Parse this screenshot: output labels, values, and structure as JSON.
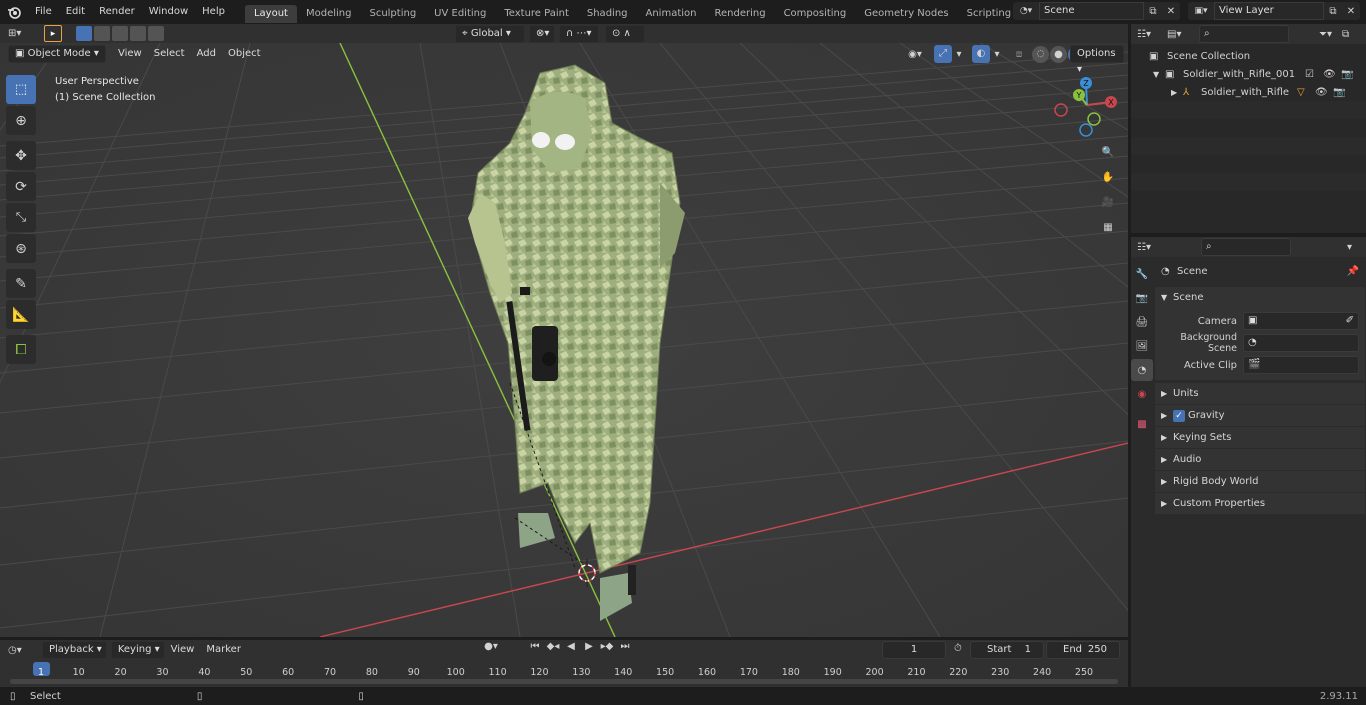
{
  "topbar": {
    "menus": [
      "File",
      "Edit",
      "Render",
      "Window",
      "Help"
    ],
    "workspaces": [
      "Layout",
      "Modeling",
      "Sculpting",
      "UV Editing",
      "Texture Paint",
      "Shading",
      "Animation",
      "Rendering",
      "Compositing",
      "Geometry Nodes",
      "Scripting"
    ],
    "active_workspace": "Layout",
    "scene": "Scene",
    "view_layer": "View Layer"
  },
  "viewport": {
    "mode": "Object Mode",
    "menus": [
      "View",
      "Select",
      "Add",
      "Object"
    ],
    "transform_orientation": "Global",
    "options_label": "Options",
    "perspective_label": "User Perspective",
    "collection_label": "(1) Scene Collection",
    "gizmo": {
      "x": "X",
      "y": "Y",
      "z": "Z"
    }
  },
  "outliner": {
    "root": "Scene Collection",
    "items": [
      {
        "label": "Soldier_with_Rifle_001"
      },
      {
        "label": "Soldier_with_Rifle"
      }
    ]
  },
  "properties": {
    "header": "Scene",
    "section": "Scene",
    "fields": [
      {
        "label": "Camera",
        "value": ""
      },
      {
        "label": "Background Scene",
        "value": ""
      },
      {
        "label": "Active Clip",
        "value": ""
      }
    ],
    "panels": [
      "Units",
      "Gravity",
      "Keying Sets",
      "Audio",
      "Rigid Body World",
      "Custom Properties"
    ],
    "gravity_checked": true
  },
  "timeline": {
    "menus": [
      "Playback",
      "Keying",
      "View",
      "Marker"
    ],
    "current_frame": "1",
    "start_label": "Start",
    "start": "1",
    "end_label": "End",
    "end": "250",
    "ticks": [
      "1",
      "10",
      "20",
      "30",
      "40",
      "50",
      "60",
      "70",
      "80",
      "90",
      "100",
      "110",
      "120",
      "130",
      "140",
      "150",
      "160",
      "170",
      "180",
      "190",
      "200",
      "210",
      "220",
      "230",
      "240",
      "250"
    ]
  },
  "status": {
    "select_label": "Select",
    "version": "2.93.11"
  },
  "colors": {
    "accent": "#4772b3",
    "active_orange": "#e8a33c",
    "x_axis": "#c8474f",
    "y_axis": "#8ac23f",
    "z_axis": "#3a8fdb"
  }
}
